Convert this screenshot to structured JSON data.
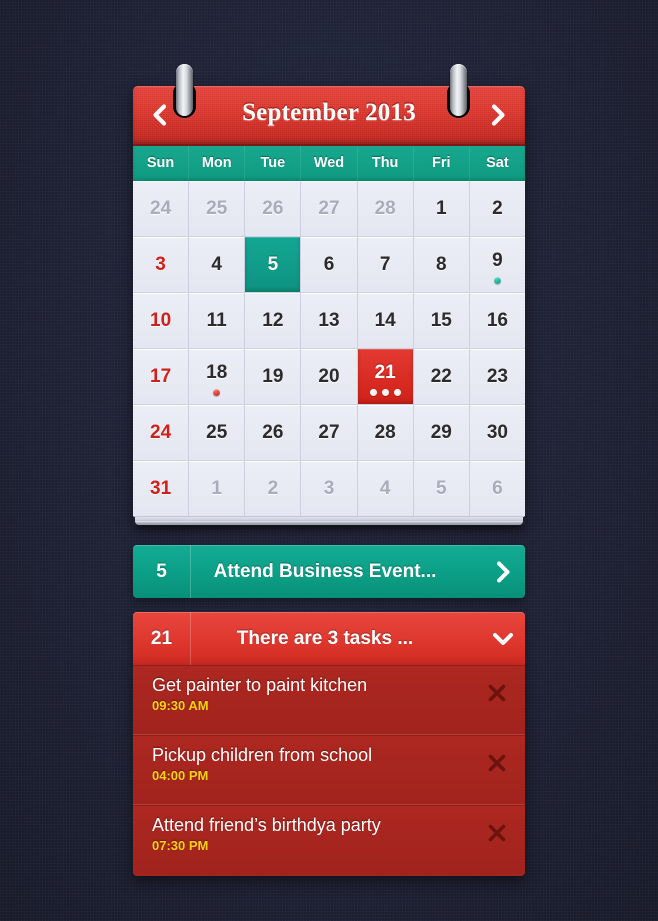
{
  "calendar": {
    "title": "September 2013",
    "prev_label": "Previous month",
    "next_label": "Next month",
    "weekdays": [
      "Sun",
      "Mon",
      "Tue",
      "Wed",
      "Thu",
      "Fri",
      "Sat"
    ],
    "days": [
      {
        "n": "24",
        "state": "muted"
      },
      {
        "n": "25",
        "state": "muted"
      },
      {
        "n": "26",
        "state": "muted"
      },
      {
        "n": "27",
        "state": "muted"
      },
      {
        "n": "28",
        "state": "muted"
      },
      {
        "n": "1",
        "state": "normal"
      },
      {
        "n": "2",
        "state": "normal"
      },
      {
        "n": "3",
        "state": "sunday"
      },
      {
        "n": "4",
        "state": "normal"
      },
      {
        "n": "5",
        "state": "selected-teal"
      },
      {
        "n": "6",
        "state": "normal"
      },
      {
        "n": "7",
        "state": "normal"
      },
      {
        "n": "8",
        "state": "normal"
      },
      {
        "n": "9",
        "state": "normal",
        "dots": [
          "teal"
        ]
      },
      {
        "n": "10",
        "state": "sunday"
      },
      {
        "n": "11",
        "state": "normal"
      },
      {
        "n": "12",
        "state": "normal"
      },
      {
        "n": "13",
        "state": "normal"
      },
      {
        "n": "14",
        "state": "normal"
      },
      {
        "n": "15",
        "state": "normal"
      },
      {
        "n": "16",
        "state": "normal"
      },
      {
        "n": "17",
        "state": "sunday"
      },
      {
        "n": "18",
        "state": "normal",
        "dots": [
          "red"
        ]
      },
      {
        "n": "19",
        "state": "normal"
      },
      {
        "n": "20",
        "state": "normal"
      },
      {
        "n": "21",
        "state": "selected-red",
        "dots": [
          "white",
          "white",
          "white"
        ]
      },
      {
        "n": "22",
        "state": "normal"
      },
      {
        "n": "23",
        "state": "normal"
      },
      {
        "n": "24",
        "state": "sunday"
      },
      {
        "n": "25",
        "state": "normal"
      },
      {
        "n": "26",
        "state": "normal"
      },
      {
        "n": "27",
        "state": "normal"
      },
      {
        "n": "28",
        "state": "normal"
      },
      {
        "n": "29",
        "state": "normal"
      },
      {
        "n": "30",
        "state": "normal"
      },
      {
        "n": "31",
        "state": "sunday"
      },
      {
        "n": "1",
        "state": "muted"
      },
      {
        "n": "2",
        "state": "muted"
      },
      {
        "n": "3",
        "state": "muted"
      },
      {
        "n": "4",
        "state": "muted"
      },
      {
        "n": "5",
        "state": "muted"
      },
      {
        "n": "6",
        "state": "muted"
      }
    ]
  },
  "event_bar": {
    "date": "5",
    "label": "Attend Business Event...",
    "chevron": "chevron-right-icon"
  },
  "tasks_bar": {
    "date": "21",
    "label": "There are 3 tasks ...",
    "chevron": "chevron-down-icon"
  },
  "tasks": [
    {
      "title": "Get painter to paint kitchen",
      "time": "09:30 AM",
      "delete": "close-icon"
    },
    {
      "title": "Pickup children from school",
      "time": "04:00 PM",
      "delete": "close-icon"
    },
    {
      "title": "Attend friend’s birthdya party",
      "time": "07:30 PM",
      "delete": "close-icon"
    }
  ],
  "colors": {
    "background": "#22253a",
    "red": "#e03a31",
    "red_dark": "#a4251f",
    "teal": "#0da189",
    "sunday": "#cf2119",
    "time_yellow": "#f5d312",
    "muted_day": "#a8acbb"
  }
}
